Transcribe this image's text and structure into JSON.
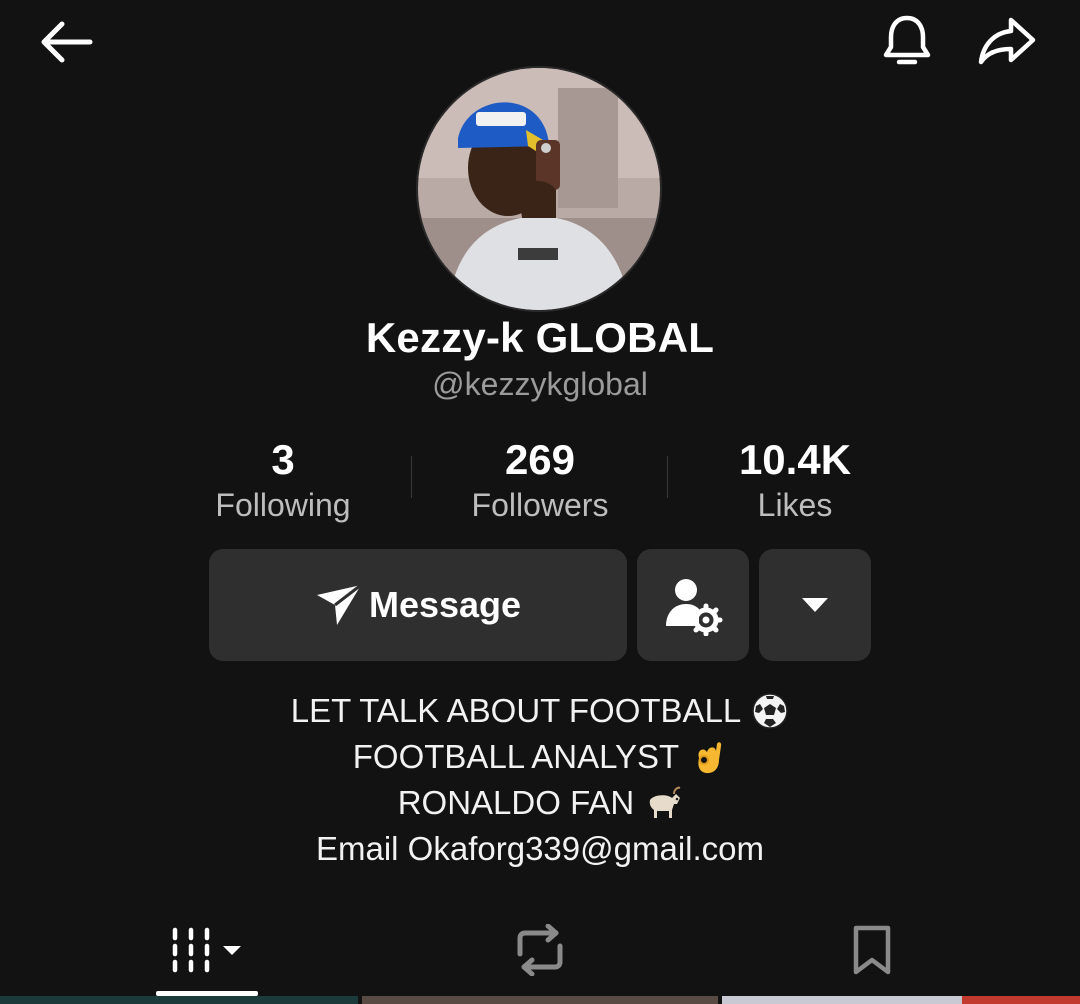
{
  "profile": {
    "display_name": "Kezzy-k GLOBAL",
    "username": "@kezzykglobal"
  },
  "stats": [
    {
      "value": "3",
      "label": "Following"
    },
    {
      "value": "269",
      "label": "Followers"
    },
    {
      "value": "10.4K",
      "label": "Likes"
    }
  ],
  "actions": {
    "message_label": "Message"
  },
  "bio": {
    "lines": [
      "LET TALK ABOUT FOOTBALL",
      "FOOTBALL ANALYST",
      "RONALDO FAN",
      "Email Okaforg339@gmail.com"
    ]
  },
  "icons": {
    "back": "back-arrow-icon",
    "bell": "bell-icon",
    "share": "share-icon",
    "message": "send-icon",
    "add_friend": "user-settings-icon",
    "more": "caret-down-icon",
    "videos_tab": "grid-icon",
    "reposts_tab": "repost-icon",
    "saved_tab": "bookmark-icon"
  },
  "colors": {
    "background": "#121212",
    "button": "#2f2f2f",
    "secondary_text": "#9b9b9b"
  }
}
